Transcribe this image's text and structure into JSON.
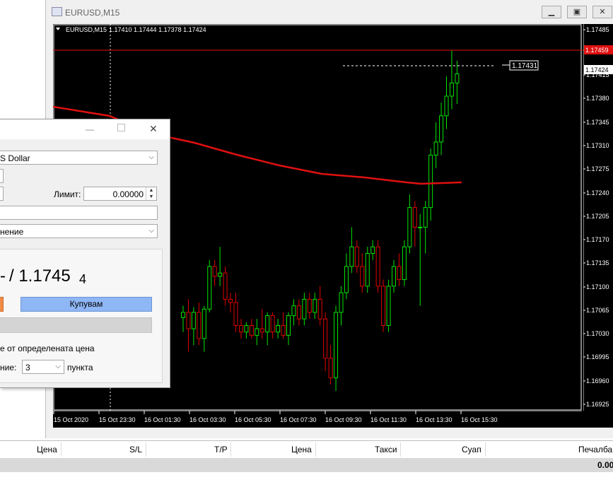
{
  "window": {
    "title": "EURUSD,M15",
    "buttons": [
      "minimize",
      "maximize",
      "close"
    ]
  },
  "chart": {
    "info": "EURUSD,M15  1.17410 1.17444 1.17378 1.17424",
    "symbol_label": "EURUSD,M15",
    "ohlc": "1.17410 1.17444 1.17378 1.17424",
    "crosshair_price": "1.17431",
    "current_price": "1.17424",
    "red_line_price": "1.17459",
    "colors": {
      "bull": "#00e600",
      "bear": "#e00000",
      "ma": "#e01010",
      "background": "#000000"
    },
    "price_ticks": [
      "1.17485",
      "1.17415",
      "1.17380",
      "1.17345",
      "1.17310",
      "1.17275",
      "1.17240",
      "1.17205",
      "1.17170",
      "1.17135",
      "1.17100",
      "1.17065",
      "1.17030",
      "1.16995",
      "1.16960",
      "1.16925"
    ],
    "time_ticks": [
      "15 Oct 2020",
      "15 Oct 23:30",
      "16 Oct 01:30",
      "16 Oct 03:30",
      "16 Oct 05:30",
      "16 Oct 07:30",
      "16 Oct 09:30",
      "16 Oct 11:30",
      "16 Oct 13:30",
      "16 Oct 15:30"
    ]
  },
  "chart_data": {
    "type": "candlestick",
    "title": "EURUSD,M15",
    "ylim": [
      1.1691,
      1.175
    ],
    "ma_series": [
      1.1737,
      1.17355,
      1.1733,
      1.1731,
      1.17298,
      1.17285,
      1.17272,
      1.17262,
      1.1725,
      1.17242,
      1.17238,
      1.1724
    ],
    "candles": [
      [
        1.17052,
        1.1707,
        1.1703,
        1.1706
      ],
      [
        1.1706,
        1.1708,
        1.17,
        1.17035
      ],
      [
        1.17035,
        1.17068,
        1.1701,
        1.1706
      ],
      [
        1.1706,
        1.17075,
        1.1701,
        1.1702
      ],
      [
        1.1702,
        1.1707,
        1.17,
        1.17065
      ],
      [
        1.17065,
        1.1714,
        1.1706,
        1.1713
      ],
      [
        1.1713,
        1.1714,
        1.171,
        1.17115
      ],
      [
        1.17115,
        1.1716,
        1.171,
        1.1712
      ],
      [
        1.1712,
        1.1713,
        1.1707,
        1.1708
      ],
      [
        1.1708,
        1.1709,
        1.1706,
        1.17075
      ],
      [
        1.17075,
        1.1709,
        1.1703,
        1.1704
      ],
      [
        1.1704,
        1.1705,
        1.1702,
        1.1703
      ],
      [
        1.1703,
        1.17045,
        1.1702,
        1.1704
      ],
      [
        1.1704,
        1.1705,
        1.1702,
        1.17025
      ],
      [
        1.17025,
        1.1705,
        1.1701,
        1.17035
      ],
      [
        1.17035,
        1.17065,
        1.1702,
        1.1703
      ],
      [
        1.1703,
        1.1706,
        1.1701,
        1.17055
      ],
      [
        1.17055,
        1.1706,
        1.1702,
        1.1703
      ],
      [
        1.1703,
        1.1705,
        1.1702,
        1.1704
      ],
      [
        1.1704,
        1.1706,
        1.1702,
        1.17025
      ],
      [
        1.17025,
        1.1706,
        1.1701,
        1.17055
      ],
      [
        1.17055,
        1.1708,
        1.1704,
        1.1707
      ],
      [
        1.1707,
        1.1708,
        1.1704,
        1.1705
      ],
      [
        1.1705,
        1.1709,
        1.1704,
        1.1708
      ],
      [
        1.1708,
        1.1709,
        1.1705,
        1.1706
      ],
      [
        1.1706,
        1.1709,
        1.1705,
        1.1708
      ],
      [
        1.1708,
        1.171,
        1.1704,
        1.1705
      ],
      [
        1.1705,
        1.1706,
        1.1697,
        1.1699
      ],
      [
        1.1699,
        1.1701,
        1.1695,
        1.1696
      ],
      [
        1.1696,
        1.1707,
        1.1694,
        1.1706
      ],
      [
        1.1706,
        1.171,
        1.1704,
        1.1709
      ],
      [
        1.1709,
        1.1715,
        1.1708,
        1.1713
      ],
      [
        1.1713,
        1.1719,
        1.1712,
        1.1716
      ],
      [
        1.1716,
        1.1717,
        1.1712,
        1.1713
      ],
      [
        1.1713,
        1.1715,
        1.1709,
        1.171
      ],
      [
        1.171,
        1.1716,
        1.1709,
        1.1715
      ],
      [
        1.1715,
        1.1717,
        1.1714,
        1.1716
      ],
      [
        1.1716,
        1.1717,
        1.1709,
        1.171
      ],
      [
        1.171,
        1.1711,
        1.1703,
        1.1704
      ],
      [
        1.1704,
        1.1711,
        1.1703,
        1.171
      ],
      [
        1.171,
        1.1714,
        1.1709,
        1.1713
      ],
      [
        1.1713,
        1.1715,
        1.171,
        1.1711
      ],
      [
        1.1711,
        1.1717,
        1.171,
        1.1716
      ],
      [
        1.1716,
        1.1724,
        1.1715,
        1.1722
      ],
      [
        1.1722,
        1.1723,
        1.1716,
        1.1719
      ],
      [
        1.1719,
        1.1721,
        1.1707,
        1.1719
      ],
      [
        1.1719,
        1.1723,
        1.1715,
        1.1722
      ],
      [
        1.1722,
        1.1731,
        1.172,
        1.173
      ],
      [
        1.173,
        1.1735,
        1.1728,
        1.1732
      ],
      [
        1.1732,
        1.1738,
        1.173,
        1.1736
      ],
      [
        1.1736,
        1.1742,
        1.1734,
        1.1739
      ],
      [
        1.1739,
        1.1746,
        1.1737,
        1.1741
      ],
      [
        1.1741,
        1.17444,
        1.17378,
        1.17424
      ]
    ]
  },
  "dialog": {
    "symbol_value": "S Dollar",
    "limit_label": "Лимит:",
    "limit_value": "0.00000",
    "type_value": "нение",
    "price_text": "/ 1.1745",
    "price_sub": "4",
    "price_prefix": "-",
    "buy_label": "Купувам",
    "deviation_text": "е от определената цена",
    "slippage_label": "ние:",
    "slippage_value": "3",
    "points_label": "пункта"
  },
  "table": {
    "headers": [
      "Цена",
      "S/L",
      "T/P",
      "Цена",
      "Такси",
      "Суап",
      "Печалба"
    ],
    "balance_value": "0.00"
  }
}
